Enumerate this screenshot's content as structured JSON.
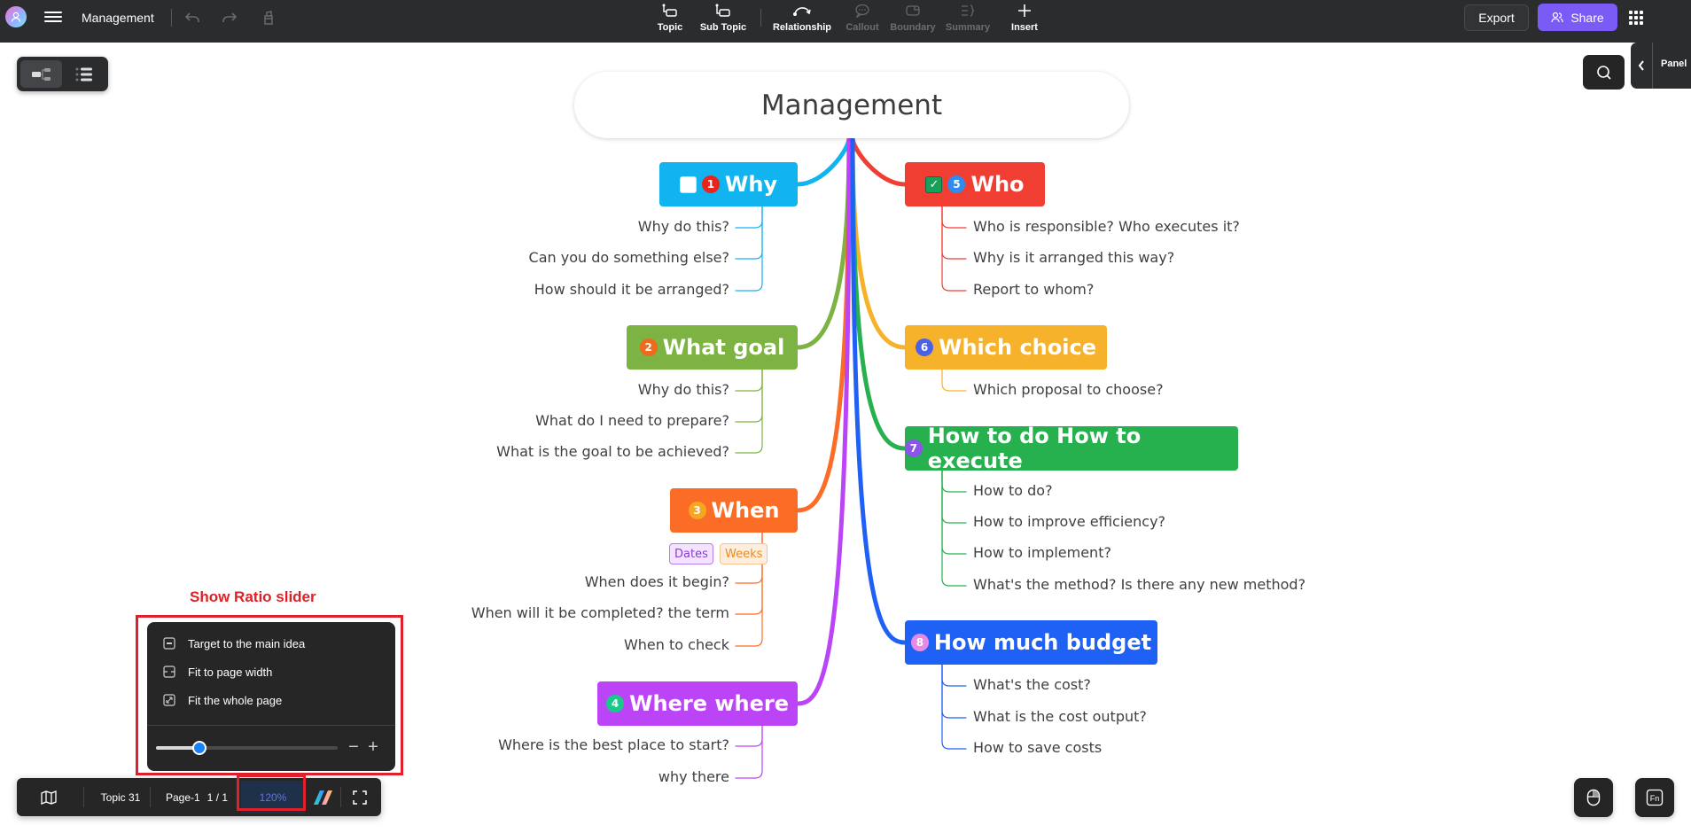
{
  "app": {
    "document_title": "Management"
  },
  "toolbar": {
    "tools": [
      {
        "label": "Topic",
        "icon": "topic-icon",
        "enabled": true
      },
      {
        "label": "Sub Topic",
        "icon": "subtopic-icon",
        "enabled": true
      },
      {
        "label": "Relationship",
        "icon": "relationship-icon",
        "enabled": true
      },
      {
        "label": "Callout",
        "icon": "callout-icon",
        "enabled": false
      },
      {
        "label": "Boundary",
        "icon": "boundary-icon",
        "enabled": false
      },
      {
        "label": "Summary",
        "icon": "summary-icon",
        "enabled": false
      },
      {
        "label": "Insert",
        "icon": "plus-icon",
        "enabled": true
      }
    ],
    "export_label": "Export",
    "share_label": "Share",
    "share_color": "#7b5bf5"
  },
  "right_panel": {
    "label": "Panel"
  },
  "mindmap": {
    "root": "Management",
    "topics": [
      {
        "id": 1,
        "title": "Why",
        "color": "#12b4f0",
        "badge": "1",
        "badge_color": "#e8241c",
        "checkbox": "unchecked",
        "subtopics": [
          "Why do this?",
          "Can you do something else?",
          "How should it be arranged?"
        ]
      },
      {
        "id": 2,
        "title": "What goal",
        "color": "#7cb342",
        "badge": "2",
        "badge_color": "#f06a1d",
        "subtopics": [
          "Why do this?",
          "What do I need to prepare?",
          "What is the goal to be achieved?"
        ]
      },
      {
        "id": 3,
        "title": "When",
        "color": "#fb6d27",
        "badge": "3",
        "badge_color": "#f5a623",
        "labels": [
          "Dates",
          "Weeks"
        ],
        "subtopics": [
          "When does it begin?",
          "When will it be completed? the term",
          "When to check"
        ]
      },
      {
        "id": 4,
        "title": "Where where",
        "color": "#bb44f7",
        "badge": "4",
        "badge_color": "#18c98a",
        "subtopics": [
          "Where is the best place to start?",
          "why there"
        ]
      },
      {
        "id": 5,
        "title": "Who",
        "color": "#f03e32",
        "badge": "5",
        "badge_color": "#2e8cf0",
        "checkbox": "checked",
        "subtopics": [
          "Who is responsible? Who executes it?",
          "Why is it arranged this way?",
          "Report to whom?"
        ]
      },
      {
        "id": 6,
        "title": "Which choice",
        "color": "#f6b22b",
        "badge": "6",
        "badge_color": "#4a61e8",
        "subtopics": [
          "Which proposal to choose?"
        ]
      },
      {
        "id": 7,
        "title": "How to do How to execute",
        "color": "#27b04e",
        "badge": "7",
        "badge_color": "#8a55e8",
        "subtopics": [
          "How to do?",
          "How to improve efficiency?",
          "How to implement?",
          "What's the method? Is there any new method?"
        ]
      },
      {
        "id": 8,
        "title": "How much budget",
        "color": "#1f60f5",
        "badge": "8",
        "badge_color": "#e58be6",
        "subtopics": [
          "What's the cost?",
          "What is the cost output?",
          "How to save costs"
        ]
      }
    ]
  },
  "annotation": {
    "label": "Show Ratio slider",
    "color": "#dc2127"
  },
  "zoom_popup": {
    "items": [
      {
        "label": "Target to the main idea",
        "icon": "target-icon"
      },
      {
        "label": "Fit to page width",
        "icon": "fit-width-icon"
      },
      {
        "label": "Fit the whole page",
        "icon": "fit-page-icon"
      }
    ],
    "slider_value_fraction": 0.24
  },
  "bottombar": {
    "topic_count": "Topic 31",
    "page_name": "Page-1",
    "page_index": "1 / 1",
    "zoom": "120%"
  }
}
